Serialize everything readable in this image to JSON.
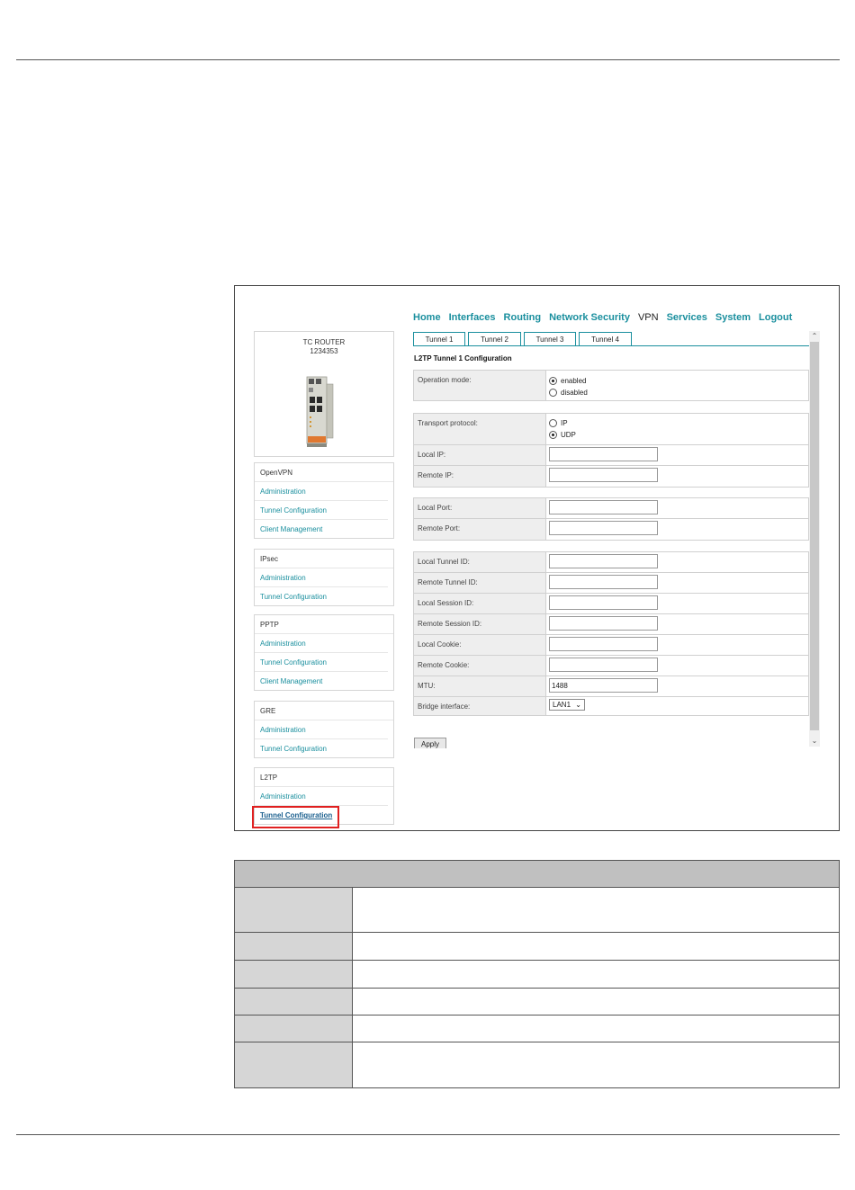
{
  "nav": [
    "Home",
    "Interfaces",
    "Routing",
    "Network Security",
    "VPN",
    "Services",
    "System",
    "Logout"
  ],
  "nav_active": "VPN",
  "device": {
    "name": "TC ROUTER",
    "serial": "1234353"
  },
  "menu": [
    {
      "head": "OpenVPN",
      "links": [
        "Administration",
        "Tunnel Configuration",
        "Client Management"
      ]
    },
    {
      "head": "IPsec",
      "links": [
        "Administration",
        "Tunnel Configuration"
      ]
    },
    {
      "head": "PPTP",
      "links": [
        "Administration",
        "Tunnel Configuration",
        "Client Management"
      ]
    },
    {
      "head": "GRE",
      "links": [
        "Administration",
        "Tunnel Configuration"
      ]
    },
    {
      "head": "L2TP",
      "links": [
        "Administration",
        "Tunnel Configuration"
      ]
    }
  ],
  "tabs": [
    "Tunnel 1",
    "Tunnel 2",
    "Tunnel 3",
    "Tunnel 4"
  ],
  "section_title": "L2TP Tunnel 1 Configuration",
  "operation_mode": {
    "label": "Operation mode:",
    "options": [
      "enabled",
      "disabled"
    ],
    "selected": "enabled"
  },
  "transport": {
    "label": "Transport protocol:",
    "options": [
      "IP",
      "UDP"
    ],
    "selected": "UDP"
  },
  "fields": {
    "local_ip": {
      "label": "Local IP:",
      "value": ""
    },
    "remote_ip": {
      "label": "Remote IP:",
      "value": ""
    },
    "local_port": {
      "label": "Local Port:",
      "value": ""
    },
    "remote_port": {
      "label": "Remote Port:",
      "value": ""
    },
    "local_tunnel_id": {
      "label": "Local Tunnel ID:",
      "value": ""
    },
    "remote_tunnel_id": {
      "label": "Remote Tunnel ID:",
      "value": ""
    },
    "local_session_id": {
      "label": "Local Session ID:",
      "value": ""
    },
    "remote_session_id": {
      "label": "Remote Session ID:",
      "value": ""
    },
    "local_cookie": {
      "label": "Local Cookie:",
      "value": ""
    },
    "remote_cookie": {
      "label": "Remote Cookie:",
      "value": ""
    },
    "mtu": {
      "label": "MTU:",
      "value": "1488"
    }
  },
  "bridge": {
    "label": "Bridge interface:",
    "value": "LAN1"
  },
  "apply_label": "Apply"
}
